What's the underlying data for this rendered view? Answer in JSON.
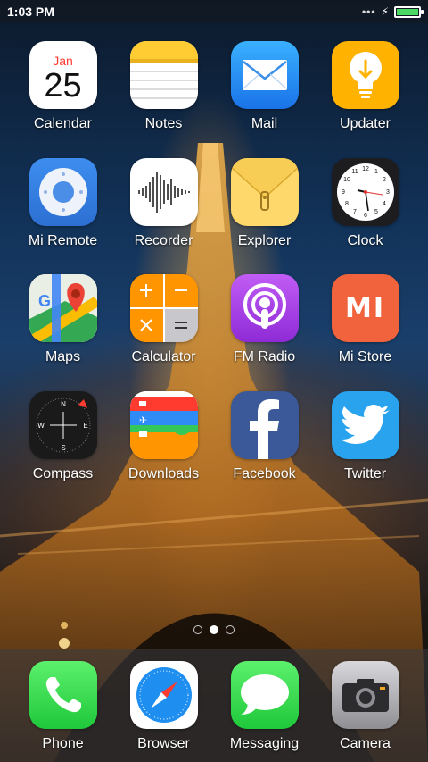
{
  "status_bar": {
    "time": "1:03 PM",
    "signal_icon": "signal-dots-icon",
    "charging_icon": "bolt-icon",
    "battery_level": 1.0,
    "battery_color": "#4cd964"
  },
  "apps": [
    {
      "label": "Calendar",
      "icon": "calendar-icon",
      "month": "Jan",
      "day": "25"
    },
    {
      "label": "Notes",
      "icon": "notes-icon"
    },
    {
      "label": "Mail",
      "icon": "mail-icon"
    },
    {
      "label": "Updater",
      "icon": "lightbulb-icon"
    },
    {
      "label": "Mi Remote",
      "icon": "remote-icon"
    },
    {
      "label": "Recorder",
      "icon": "waveform-icon"
    },
    {
      "label": "Explorer",
      "icon": "folder-icon"
    },
    {
      "label": "Clock",
      "icon": "clock-icon"
    },
    {
      "label": "Maps",
      "icon": "map-pin-icon"
    },
    {
      "label": "Calculator",
      "icon": "calculator-icon"
    },
    {
      "label": "FM Radio",
      "icon": "podcast-icon"
    },
    {
      "label": "Mi Store",
      "icon": "mi-logo-icon",
      "logo_text": "MI"
    },
    {
      "label": "Compass",
      "icon": "compass-icon"
    },
    {
      "label": "Downloads",
      "icon": "wallet-icon"
    },
    {
      "label": "Facebook",
      "icon": "facebook-icon"
    },
    {
      "label": "Twitter",
      "icon": "bird-icon"
    }
  ],
  "page_indicator": {
    "pages": 3,
    "active": 2
  },
  "dock": [
    {
      "label": "Phone",
      "icon": "phone-icon"
    },
    {
      "label": "Browser",
      "icon": "compass-safari-icon"
    },
    {
      "label": "Messaging",
      "icon": "speech-bubble-icon"
    },
    {
      "label": "Camera",
      "icon": "camera-icon"
    }
  ]
}
